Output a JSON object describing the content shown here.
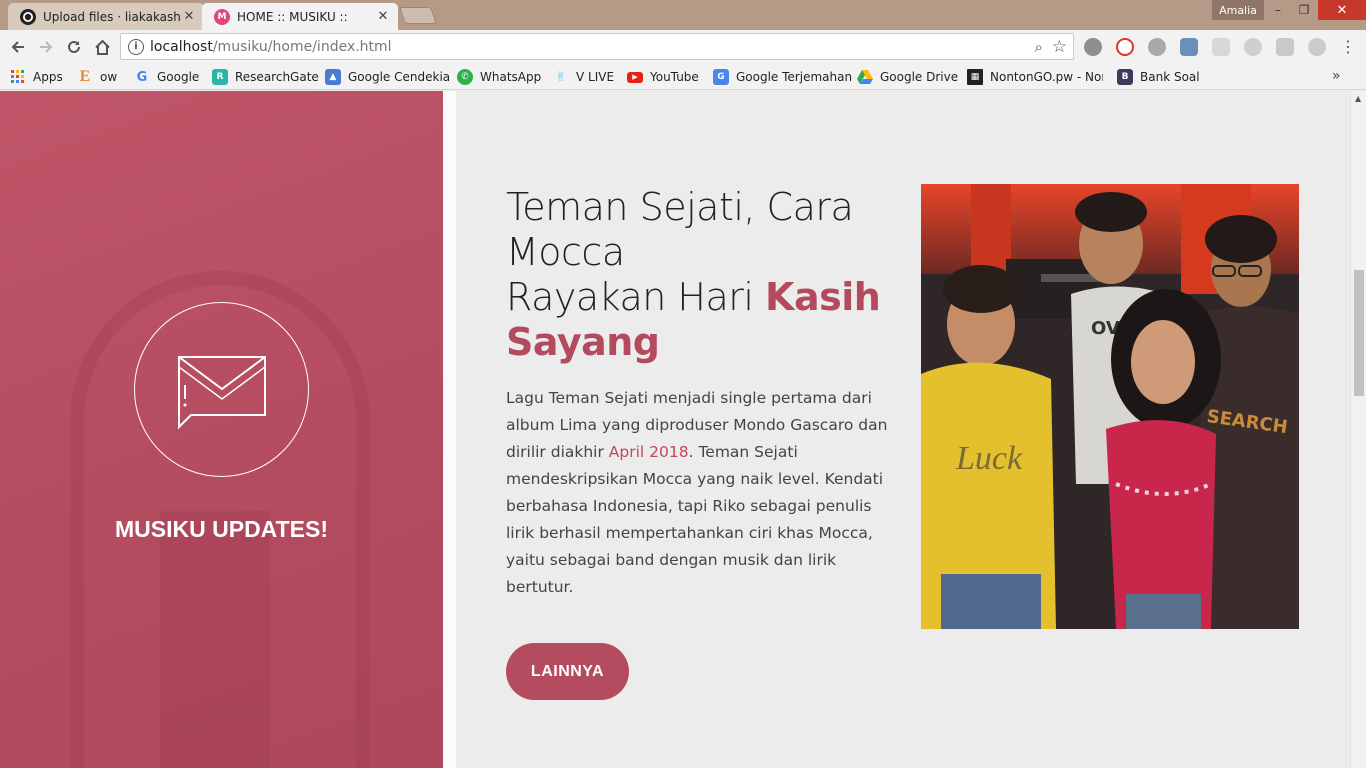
{
  "browser": {
    "tabs": [
      {
        "title": "Upload files · liakakashi/A",
        "active": false,
        "close": "✕"
      },
      {
        "title": "HOME :: MUSIKU ::",
        "active": true,
        "close": "✕"
      }
    ],
    "profile_name": "Amalia",
    "window_controls": {
      "minimize": "–",
      "restore": "❐",
      "close": "✕"
    },
    "address": {
      "host": "localhost",
      "path": "/musiku/home/index.html"
    },
    "bookmarks": [
      {
        "label": "Apps",
        "icon": "apps-grid-icon"
      },
      {
        "label": "ow",
        "icon": "e-icon"
      },
      {
        "label": "Google",
        "icon": "google-icon"
      },
      {
        "label": "ResearchGate",
        "icon": "researchgate-icon"
      },
      {
        "label": "Google Cendekia",
        "icon": "scholar-icon"
      },
      {
        "label": "WhatsApp",
        "icon": "whatsapp-icon"
      },
      {
        "label": "V LIVE",
        "icon": "vlive-icon"
      },
      {
        "label": "YouTube",
        "icon": "youtube-icon"
      },
      {
        "label": "Google Terjemahan",
        "icon": "translate-icon"
      },
      {
        "label": "Google Drive",
        "icon": "drive-icon"
      },
      {
        "label": "NontonGO.pw - Nor",
        "icon": "film-icon"
      },
      {
        "label": "Bank Soal",
        "icon": "b-icon"
      }
    ],
    "bookmarks_more": "»"
  },
  "page": {
    "side_title": "MUSIKU UPDATES!",
    "headline": {
      "line1": "Teman Sejati, Cara",
      "line2": "Mocca",
      "line3_plain": "Rayakan Hari ",
      "line3_highlight": "Kasih",
      "line4_highlight": "Sayang"
    },
    "body": {
      "before_link": "Lagu Teman Sejati menjadi single pertama dari album Lima yang diproduser Mondo Gascaro dan dirilir diakhir ",
      "link": "April 2018",
      "after_link": ". Teman Sejati mendeskripsikan Mocca yang naik level. Kendati berbahasa Indonesia, tapi Riko sebagai penulis lirik berhasil mempertahankan ciri khas Mocca, yaitu sebagai band dengan musik dan lirik bertutur."
    },
    "more_button": "LAINNYA",
    "shirt_texts": {
      "t1": "Luck",
      "t2": "OVL",
      "t3": "SEARCH"
    }
  },
  "colors": {
    "accent": "#b34a5d",
    "panel": "#b64d61",
    "link": "#c0485d"
  }
}
